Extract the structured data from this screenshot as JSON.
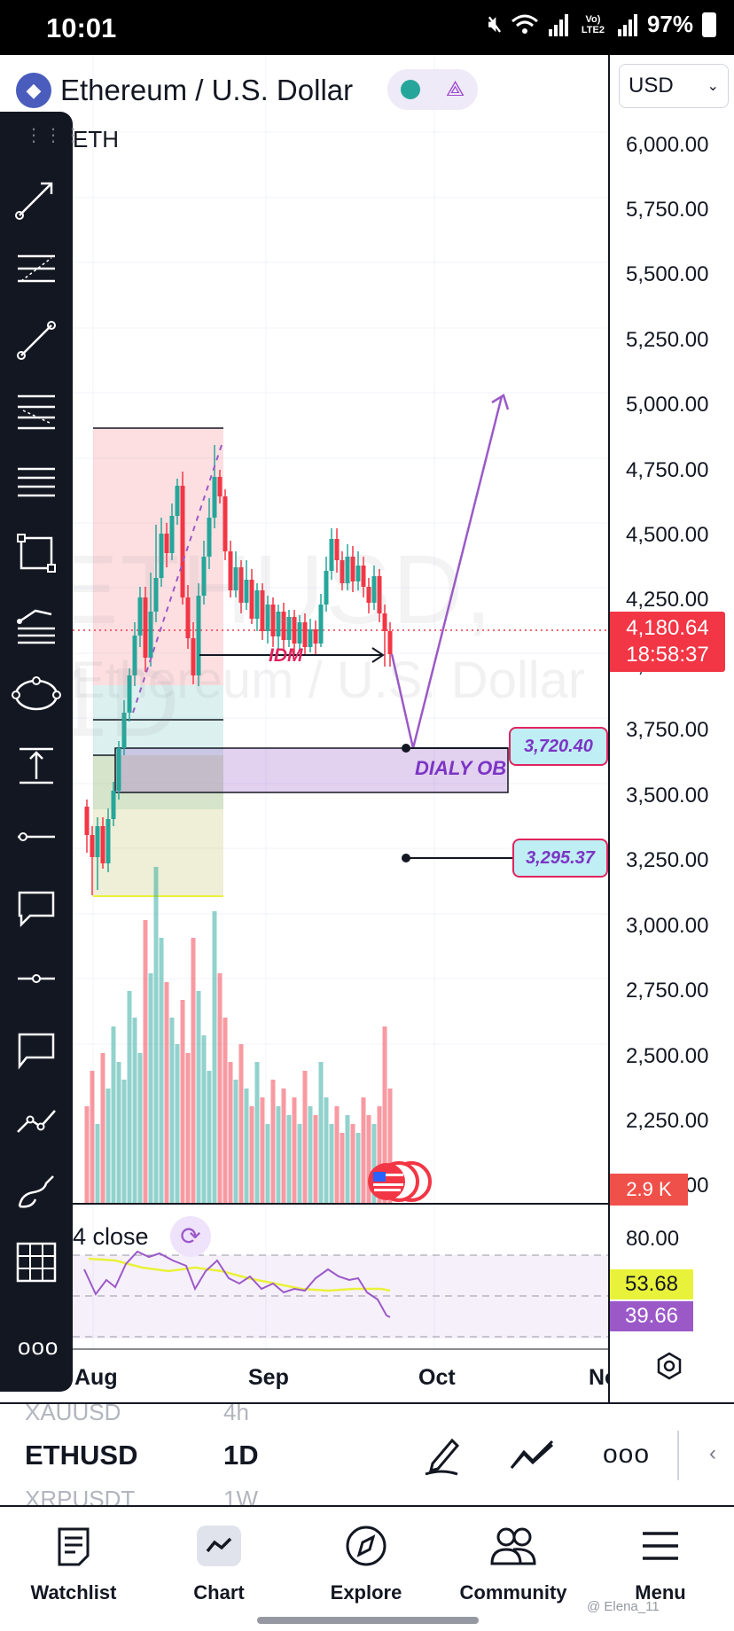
{
  "status_bar": {
    "time": "10:01",
    "network_type": "Vo) LTE2",
    "battery_percent": "97%",
    "icons": [
      "mute-icon",
      "wifi-icon",
      "signal-icon",
      "battery-icon"
    ]
  },
  "header": {
    "title": "Ethereum / U.S. Dollar",
    "subticker": "ETH",
    "currency": "USD",
    "status_color": "#26a69a"
  },
  "watermark": {
    "ticker": "ETHUSD, 1D",
    "name": "Ethereum / U.S. Dollar"
  },
  "price_scale": {
    "ticks": [
      "6,000.00",
      "5,750.00",
      "5,500.00",
      "5,250.00",
      "5,000.00",
      "4,750.00",
      "4,500.00",
      "4,250.00",
      "4,000.00",
      "3,750.00",
      "3,500.00",
      "3,250.00",
      "3,000.00",
      "2,750.00",
      "2,500.00",
      "2,250.00",
      "2,000.00"
    ],
    "current_price": "4,180.64",
    "countdown": "18:58:37",
    "volume_badge": "2.9 K",
    "rsi_top": "80.00",
    "rsi_value": "53.68",
    "rsi_ma": "39.66"
  },
  "annotations": {
    "idm": "IDM",
    "ob_label": "DIALY OB",
    "level1": "3,720.40",
    "level2": "3,295.37"
  },
  "rsi_pane": {
    "label": "4 close"
  },
  "time_axis": [
    "Aug",
    "Sep",
    "Oct",
    "No"
  ],
  "toolbar": {
    "tools": [
      "trend-line-icon",
      "fib-retracement-icon",
      "line-icon",
      "pitchfork-icon",
      "parallel-channel-icon",
      "rectangle-icon",
      "path-icon",
      "ellipse-icon",
      "measure-icon",
      "horizontal-ray-icon",
      "callout-icon",
      "horizontal-line-icon",
      "comment-icon",
      "polyline-icon",
      "brush-icon",
      "grid-icon"
    ]
  },
  "symbol_strip": {
    "prev_symbol": "XAUUSD",
    "prev_interval": "4h",
    "symbol": "ETHUSD",
    "interval": "1D",
    "next_symbol": "XRPUSDT",
    "next_interval": "1W"
  },
  "bottom_nav": {
    "items": [
      {
        "label": "Watchlist",
        "icon": "watchlist-icon"
      },
      {
        "label": "Chart",
        "icon": "chart-icon"
      },
      {
        "label": "Explore",
        "icon": "compass-icon"
      },
      {
        "label": "Community",
        "icon": "community-icon"
      },
      {
        "label": "Menu",
        "icon": "menu-icon"
      }
    ],
    "credit": "@ Elena_11"
  },
  "colors": {
    "bull": "#26a69a",
    "bear": "#f23645",
    "drawing": "#9b59c8",
    "accent_red": "#e0245e"
  }
}
